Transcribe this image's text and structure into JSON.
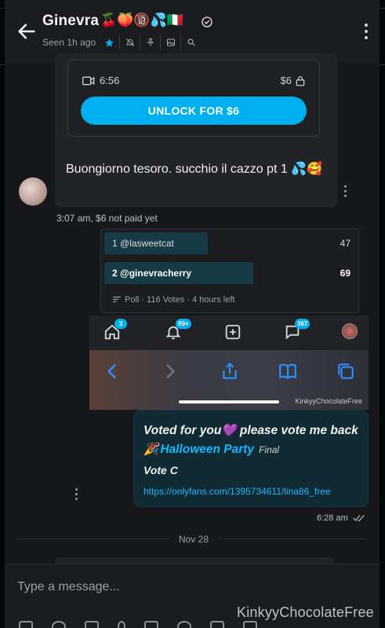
{
  "header": {
    "name": "Ginevra",
    "emojis": "🍒🍑🔞💦🇮🇹",
    "seen": "Seen 1h ago",
    "icons": [
      "star-icon",
      "mute-icon",
      "pin-icon",
      "media-icon",
      "search-icon"
    ]
  },
  "locked_message": {
    "duration": "6:56",
    "price": "$6",
    "unlock_label": "UNLOCK FOR $6",
    "text": "Buongiorno tesoro. succhio il cazzo pt 1 💦🥰",
    "time": "3:07 am,",
    "payment_status": "$6 not paid yet"
  },
  "poll": {
    "options": [
      {
        "label": "1 @lasweetcat",
        "votes": "47",
        "share": 0.41
      },
      {
        "label": "2 @ginevracherry",
        "votes": "69",
        "share": 0.59
      }
    ],
    "meta": "Poll · 116 Votes · 4 hours left"
  },
  "overlay": {
    "tab_badges": [
      "3",
      "99+",
      "367"
    ],
    "watermark": "KinkyyChocolateFree"
  },
  "my_message": {
    "line1": "Voted for you💜 please vote me back",
    "line2_emoji": "🎉",
    "line2_title": "Halloween Party",
    "line2_suffix": "Final",
    "line3": "Vote C",
    "link": "https://onlyfans.com/1395734611/lina86_free",
    "time": "6:28 am"
  },
  "date_divider": "Nov 28",
  "composer": {
    "placeholder": "Type a message..."
  },
  "watermark": "KinkyyChocolateFree",
  "colors": {
    "accent": "#00aff0",
    "background": "#16181b",
    "bubble_mine": "#122a33",
    "poll_bar": "#163a46"
  }
}
